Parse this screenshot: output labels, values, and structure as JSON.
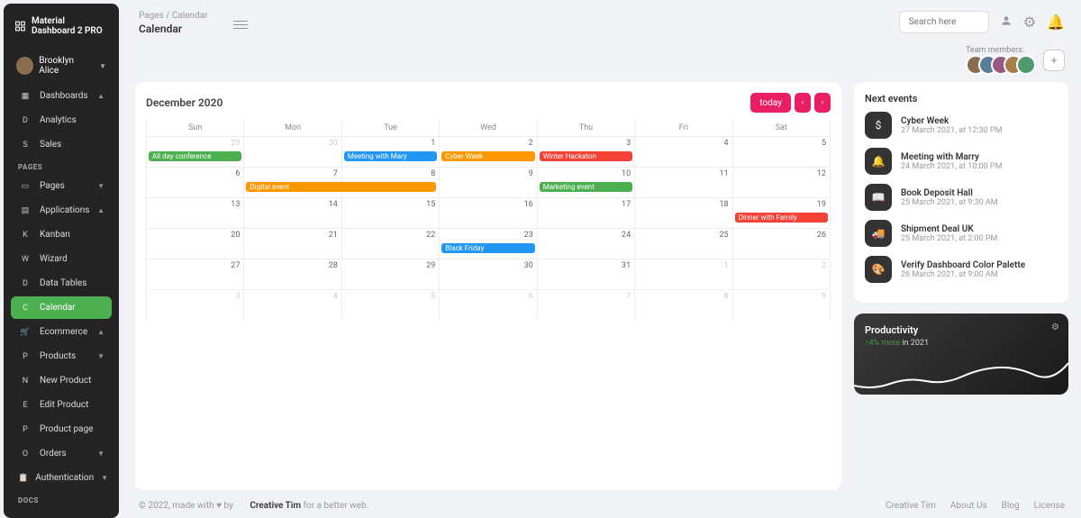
{
  "brand": "Material Dashboard 2 PRO",
  "user": {
    "name": "Brooklyn Alice"
  },
  "sidebar": {
    "dashboards_label": "Dashboards",
    "dashboards": [
      {
        "initial": "D",
        "label": "Analytics"
      },
      {
        "initial": "S",
        "label": "Sales"
      }
    ],
    "pages_section": "PAGES",
    "pages_label": "Pages",
    "applications_label": "Applications",
    "applications": [
      {
        "initial": "K",
        "label": "Kanban"
      },
      {
        "initial": "W",
        "label": "Wizard"
      },
      {
        "initial": "D",
        "label": "Data Tables"
      },
      {
        "initial": "C",
        "label": "Calendar",
        "active": true
      }
    ],
    "ecommerce_label": "Ecommerce",
    "ecommerce": [
      {
        "initial": "P",
        "label": "Products"
      },
      {
        "initial": "N",
        "label": "New Product"
      },
      {
        "initial": "E",
        "label": "Edit Product"
      },
      {
        "initial": "P",
        "label": "Product page"
      },
      {
        "initial": "O",
        "label": "Orders"
      }
    ],
    "auth_label": "Authentication",
    "docs_section": "DOCS"
  },
  "breadcrumb": {
    "root": "Pages",
    "current": "Calendar"
  },
  "page_title": "Calendar",
  "search_placeholder": "Search here",
  "team_label": "Team members:",
  "team_colors": [
    "#8a6d4d",
    "#5a7d9a",
    "#9a5a7d",
    "#a87d4d",
    "#4d9a6d"
  ],
  "calendar": {
    "month": "December 2020",
    "today_label": "today",
    "days": [
      "Sun",
      "Mon",
      "Tue",
      "Wed",
      "Thu",
      "Fri",
      "Sat"
    ],
    "weeks": [
      [
        {
          "d": "29",
          "m": true
        },
        {
          "d": "30",
          "m": true
        },
        {
          "d": "1"
        },
        {
          "d": "2"
        },
        {
          "d": "3"
        },
        {
          "d": "4"
        },
        {
          "d": "5"
        }
      ],
      [
        {
          "d": "6"
        },
        {
          "d": "7"
        },
        {
          "d": "8"
        },
        {
          "d": "9"
        },
        {
          "d": "10"
        },
        {
          "d": "11"
        },
        {
          "d": "12"
        }
      ],
      [
        {
          "d": "13"
        },
        {
          "d": "14"
        },
        {
          "d": "15"
        },
        {
          "d": "16"
        },
        {
          "d": "17"
        },
        {
          "d": "18"
        },
        {
          "d": "19"
        }
      ],
      [
        {
          "d": "20"
        },
        {
          "d": "21"
        },
        {
          "d": "22"
        },
        {
          "d": "23"
        },
        {
          "d": "24"
        },
        {
          "d": "25"
        },
        {
          "d": "26"
        }
      ],
      [
        {
          "d": "27"
        },
        {
          "d": "28"
        },
        {
          "d": "29"
        },
        {
          "d": "30"
        },
        {
          "d": "31"
        },
        {
          "d": "1",
          "m": true
        },
        {
          "d": "2",
          "m": true
        }
      ],
      [
        {
          "d": "3",
          "m": true
        },
        {
          "d": "4",
          "m": true
        },
        {
          "d": "5",
          "m": true
        },
        {
          "d": "6",
          "m": true
        },
        {
          "d": "7",
          "m": true
        },
        {
          "d": "8",
          "m": true
        },
        {
          "d": "9",
          "m": true
        }
      ]
    ],
    "events": [
      {
        "row": 0,
        "col": 0,
        "span": 1,
        "label": "All day conference",
        "color": "ev-green"
      },
      {
        "row": 0,
        "col": 2,
        "span": 1,
        "label": "Meeting with Mary",
        "color": "ev-blue"
      },
      {
        "row": 0,
        "col": 3,
        "span": 1,
        "label": "Cyber Week",
        "color": "ev-orange"
      },
      {
        "row": 0,
        "col": 4,
        "span": 1,
        "label": "Winter Hackaton",
        "color": "ev-red"
      },
      {
        "row": 1,
        "col": 1,
        "span": 2,
        "label": "Digital event",
        "color": "ev-orange"
      },
      {
        "row": 1,
        "col": 4,
        "span": 1,
        "label": "Marketing event",
        "color": "ev-green"
      },
      {
        "row": 2,
        "col": 6,
        "span": 1,
        "label": "Dinner with Family",
        "color": "ev-red"
      },
      {
        "row": 3,
        "col": 3,
        "span": 1,
        "label": "Black Friday",
        "color": "ev-blue"
      }
    ]
  },
  "next_events": {
    "title": "Next events",
    "items": [
      {
        "icon": "$",
        "title": "Cyber Week",
        "time": "27 March 2021, at 12:30 PM"
      },
      {
        "icon": "🔔",
        "title": "Meeting with Marry",
        "time": "24 March 2021, at 10:00 PM"
      },
      {
        "icon": "📖",
        "title": "Book Deposit Hall",
        "time": "25 March 2021, at 9:30 AM"
      },
      {
        "icon": "🚚",
        "title": "Shipment Deal UK",
        "time": "25 March 2021, at 2:00 PM"
      },
      {
        "icon": "🎨",
        "title": "Verify Dashboard Color Palette",
        "time": "26 March 2021, at 9:00 AM"
      }
    ]
  },
  "productivity": {
    "title": "Productivity",
    "delta": "4% more",
    "suffix": " in 2021"
  },
  "footer": {
    "copy_prefix": "© 2022, made with ",
    "heart": "♥",
    "by": " by ",
    "brand": "Creative Tim",
    "suffix": " for a better web.",
    "links": [
      "Creative Tim",
      "About Us",
      "Blog",
      "License"
    ]
  }
}
